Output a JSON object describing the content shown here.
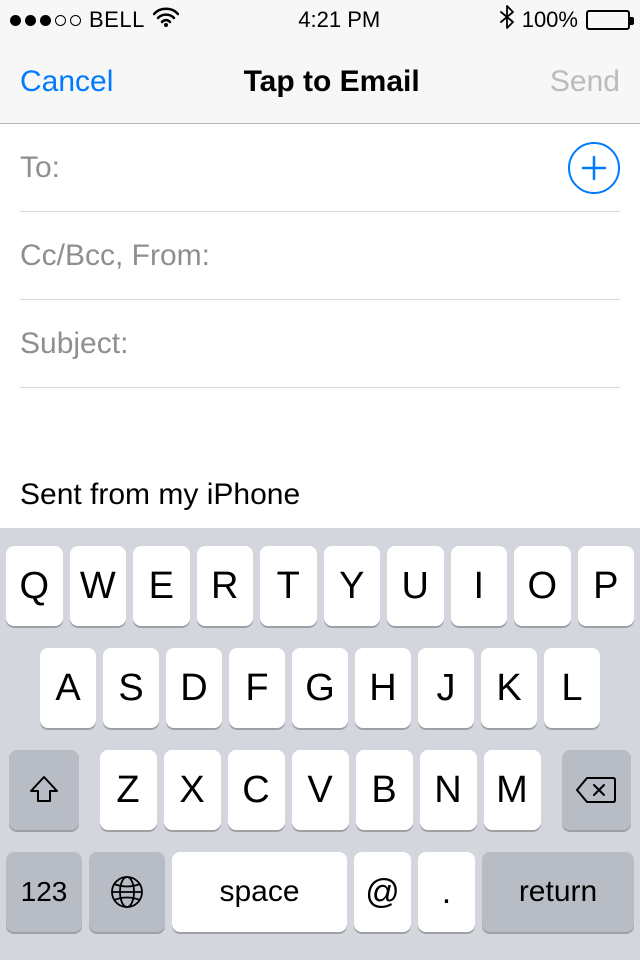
{
  "status": {
    "carrier": "BELL",
    "time": "4:21 PM",
    "battery_pct": "100%"
  },
  "nav": {
    "cancel": "Cancel",
    "title": "Tap to Email",
    "send": "Send"
  },
  "fields": {
    "to_label": "To:",
    "cc_label": "Cc/Bcc, From:",
    "subject_label": "Subject:"
  },
  "body": {
    "signature": "Sent from my iPhone"
  },
  "keyboard": {
    "row1": [
      "Q",
      "W",
      "E",
      "R",
      "T",
      "Y",
      "U",
      "I",
      "O",
      "P"
    ],
    "row2": [
      "A",
      "S",
      "D",
      "F",
      "G",
      "H",
      "J",
      "K",
      "L"
    ],
    "row3": [
      "Z",
      "X",
      "C",
      "V",
      "B",
      "N",
      "M"
    ],
    "mode_key": "123",
    "space": "space",
    "at": "@",
    "dot": ".",
    "return": "return"
  }
}
